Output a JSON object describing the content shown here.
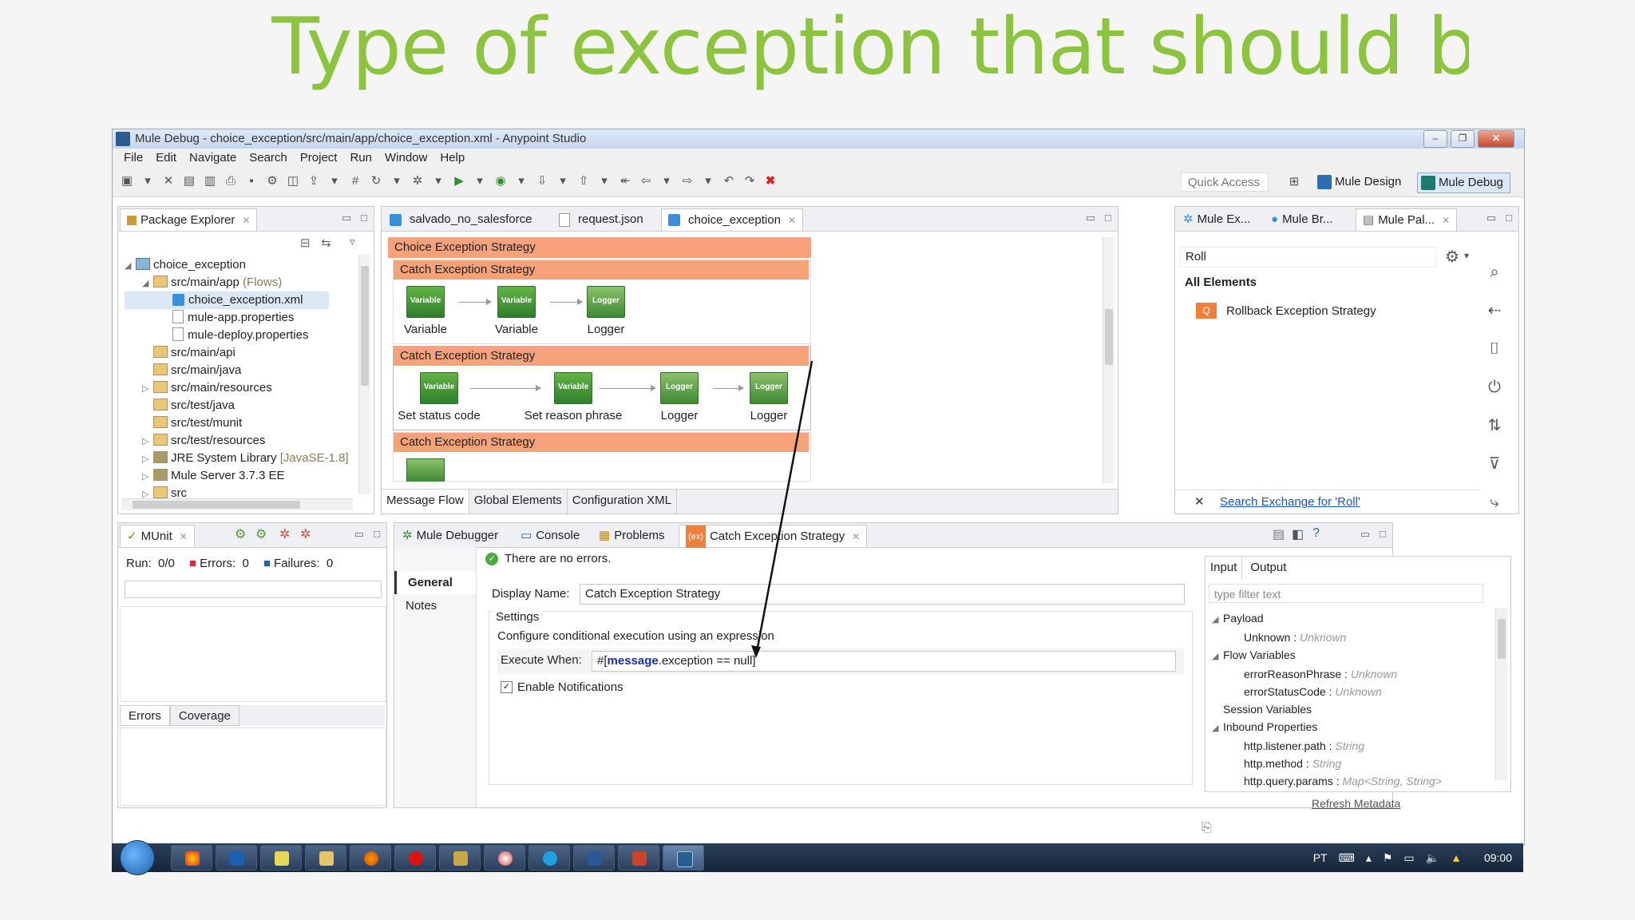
{
  "slide": {
    "title": "Type of exception that should be treated"
  },
  "window": {
    "title": "Mule Debug - choice_exception/src/main/app/choice_exception.xml - Anypoint Studio"
  },
  "menu": [
    "File",
    "Edit",
    "Navigate",
    "Search",
    "Project",
    "Run",
    "Window",
    "Help"
  ],
  "toolbar": {
    "quick_access": "Quick Access",
    "mule_design": "Mule Design",
    "mule_debug": "Mule Debug"
  },
  "package_explorer": {
    "tab": "Package Explorer",
    "tree": {
      "root": "choice_exception",
      "src_main_app": "src/main/app",
      "flows_hint": "(Flows)",
      "files": [
        "choice_exception.xml",
        "mule-app.properties",
        "mule-deploy.properties"
      ],
      "folders": [
        "src/main/api",
        "src/main/java",
        "src/main/resources",
        "src/test/java",
        "src/test/munit",
        "src/test/resources"
      ],
      "jre": "JRE System Library",
      "jre_hint": "[JavaSE-1.8]",
      "mule_server": "Mule Server 3.7.3 EE",
      "src": "src"
    }
  },
  "editor": {
    "tabs": [
      "salvado_no_salesforce",
      "request.json",
      "choice_exception"
    ],
    "choice_strategy": "Choice Exception Strategy",
    "catch_strategy": "Catch Exception Strategy",
    "node_icon_variable": "Variable",
    "node_icon_logger": "Logger",
    "flow1": [
      "Variable",
      "Variable",
      "Logger"
    ],
    "flow2": [
      "Set status code",
      "Set reason phrase",
      "Logger",
      "Logger"
    ],
    "bottom_tabs": [
      "Message Flow",
      "Global Elements",
      "Configuration XML"
    ]
  },
  "palette": {
    "tabs": [
      "Mule Ex...",
      "Mule Br...",
      "Mule Pal..."
    ],
    "search": "Roll",
    "section": "All Elements",
    "item": "Rollback Exception Strategy",
    "exchange_link": "Search Exchange for 'Roll'"
  },
  "munit": {
    "tab": "MUnit",
    "run_label": "Run:",
    "run_value": "0/0",
    "errors_label": "Errors:",
    "errors_value": "0",
    "failures_label": "Failures:",
    "failures_value": "0",
    "tabs": [
      "Errors",
      "Coverage"
    ]
  },
  "properties": {
    "tabs": [
      "Mule Debugger",
      "Console",
      "Problems",
      "Catch Exception Strategy"
    ],
    "status": "There are no errors.",
    "side_tabs": [
      "General",
      "Notes"
    ],
    "display_name_label": "Display Name:",
    "display_name": "Catch Exception Strategy",
    "settings": "Settings",
    "settings_desc": "Configure conditional execution using an expression",
    "execute_when_label": "Execute When:",
    "execute_when_prefix": "#[",
    "execute_when_keyword": "message",
    "execute_when_suffix": ".exception == null]",
    "enable_notifications": "Enable  Notifications",
    "enable_notifications_checked": true
  },
  "metadata": {
    "tabs": [
      "Input",
      "Output"
    ],
    "filter_placeholder": "type filter text",
    "payload": "Payload",
    "unknown_item": "Unknown",
    "flow_vars": "Flow Variables",
    "error_reason": "errorReasonPhrase",
    "error_status": "errorStatusCode",
    "session_vars": "Session Variables",
    "inbound_props": "Inbound Properties",
    "listener_path": "http.listener.path",
    "method": "http.method",
    "query_params": "http.query.params",
    "type_unknown": "Unknown",
    "type_string": "String",
    "type_map": "Map<String, String>",
    "refresh": "Refresh Metadata"
  },
  "taskbar": {
    "lang": "PT",
    "time": "09:00"
  }
}
